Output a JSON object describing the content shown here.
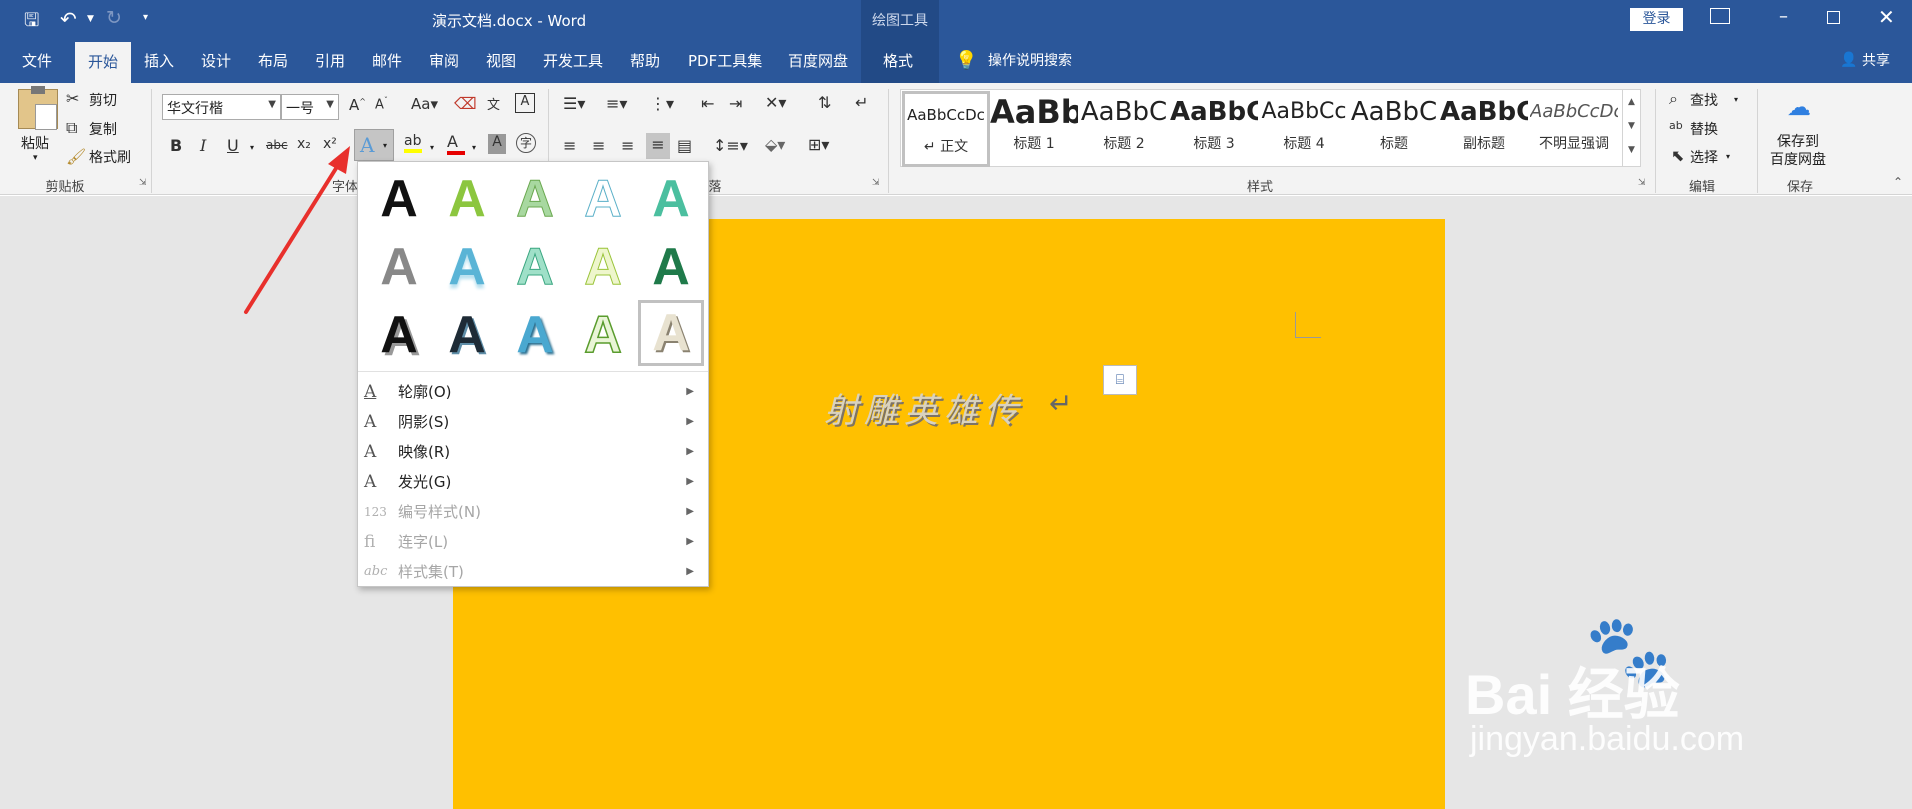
{
  "title_bar": {
    "document_title": "演示文档.docx  -  Word",
    "contextual_group": "绘图工具",
    "login_label": "登录"
  },
  "tabs": [
    "文件",
    "开始",
    "插入",
    "设计",
    "布局",
    "引用",
    "邮件",
    "审阅",
    "视图",
    "开发工具",
    "帮助",
    "PDF工具集",
    "百度网盘",
    "格式"
  ],
  "active_tab": "开始",
  "tell_me": "操作说明搜索",
  "share": "共享",
  "clipboard": {
    "paste": "粘贴",
    "cut": "剪切",
    "copy": "复制",
    "format_painter": "格式刷",
    "group": "剪贴板"
  },
  "font": {
    "font_name": "华文行楷",
    "font_size": "一号",
    "group_partial": "字体"
  },
  "paragraph": {
    "group_partial": "落"
  },
  "styles": {
    "group": "样式",
    "items": [
      {
        "preview": "AaBbCcDc",
        "name": "↵ 正文"
      },
      {
        "preview": "AaBb",
        "name": "标题 1"
      },
      {
        "preview": "AaBbC",
        "name": "标题 2"
      },
      {
        "preview": "AaBbC",
        "name": "标题 3"
      },
      {
        "preview": "AaBbCc",
        "name": "标题 4"
      },
      {
        "preview": "AaBbC",
        "name": "标题"
      },
      {
        "preview": "AaBbC",
        "name": "副标题"
      },
      {
        "preview": "AaBbCcDc",
        "name": "不明显强调"
      }
    ]
  },
  "editing": {
    "find": "查找",
    "replace": "替换",
    "select": "选择",
    "group": "编辑"
  },
  "save": {
    "save_to": "保存到",
    "baidu_disk": "百度网盘",
    "group": "保存"
  },
  "text_effects_menu": {
    "gallery_letter": "A",
    "items": [
      {
        "label": "轮廓(O)",
        "icon": "A",
        "enabled": true
      },
      {
        "label": "阴影(S)",
        "icon": "A",
        "enabled": true
      },
      {
        "label": "映像(R)",
        "icon": "A",
        "enabled": true
      },
      {
        "label": "发光(G)",
        "icon": "A",
        "enabled": true
      },
      {
        "label": "编号样式(N)",
        "icon": "123",
        "enabled": false
      },
      {
        "label": "连字(L)",
        "icon": "fi",
        "enabled": false
      },
      {
        "label": "样式集(T)",
        "icon": "abc",
        "enabled": false
      }
    ]
  },
  "document": {
    "text": "射雕英雄传"
  },
  "watermark": {
    "brand": "Bai 经验",
    "url": "jingyan.baidu.com"
  },
  "colors": {
    "accent": "#2b579a",
    "page": "#ffc000",
    "annotation_arrow": "#e8302c"
  }
}
